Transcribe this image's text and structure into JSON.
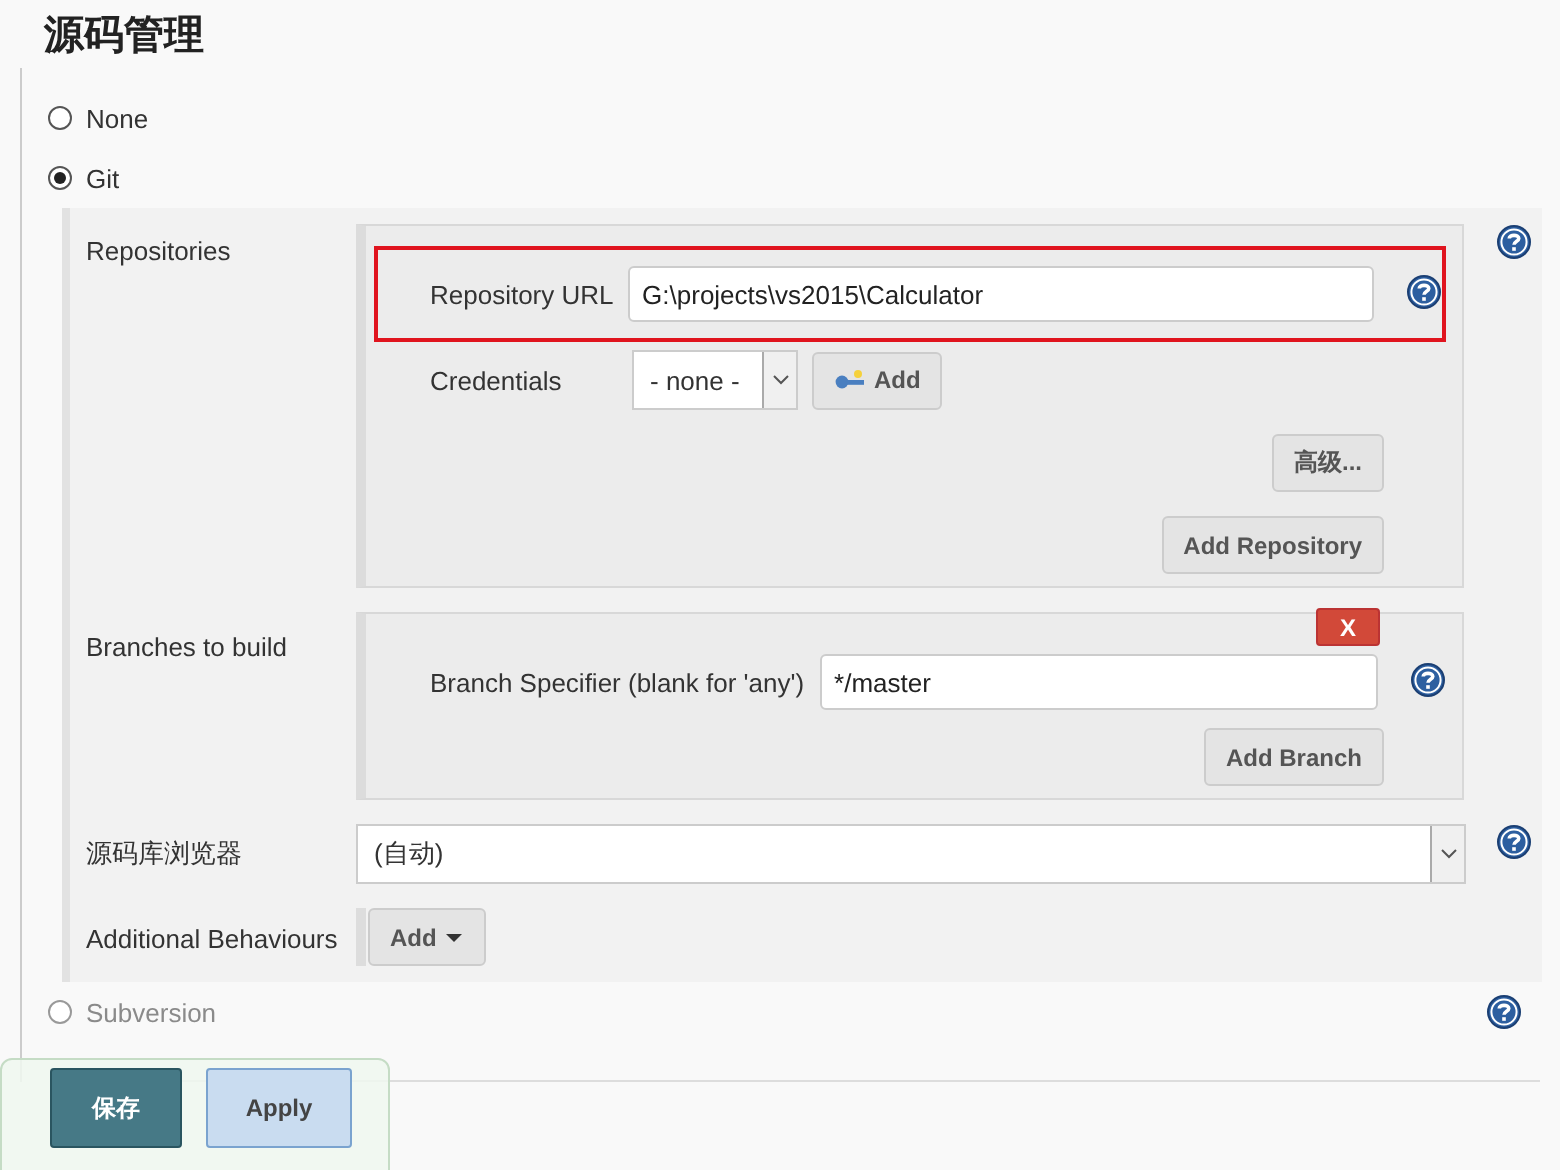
{
  "section_title": "源码管理",
  "scm_options": [
    {
      "label": "None",
      "selected": false
    },
    {
      "label": "Git",
      "selected": true
    },
    {
      "label": "Subversion",
      "selected": false
    }
  ],
  "git": {
    "repositories_label": "Repositories",
    "repository_url": {
      "label": "Repository URL",
      "value": "G:\\projects\\vs2015\\Calculator",
      "highlighted": true
    },
    "credentials": {
      "label": "Credentials",
      "value": "- none -",
      "add_button": "Add"
    },
    "advanced_button": "高级...",
    "add_repository_button": "Add Repository",
    "branches": {
      "label": "Branches to build",
      "delete_button": "X",
      "specifier_label": "Branch Specifier (blank for 'any')",
      "value": "*/master",
      "add_branch_button": "Add Branch"
    },
    "browser": {
      "label": "源码库浏览器",
      "value": "(自动)"
    },
    "additional_behaviours": {
      "label": "Additional Behaviours",
      "add_button": "Add"
    }
  },
  "save_bar": {
    "buttons": [
      {
        "label": "保存",
        "kind": "primary"
      },
      {
        "label": "Apply",
        "kind": "secondary"
      }
    ]
  }
}
